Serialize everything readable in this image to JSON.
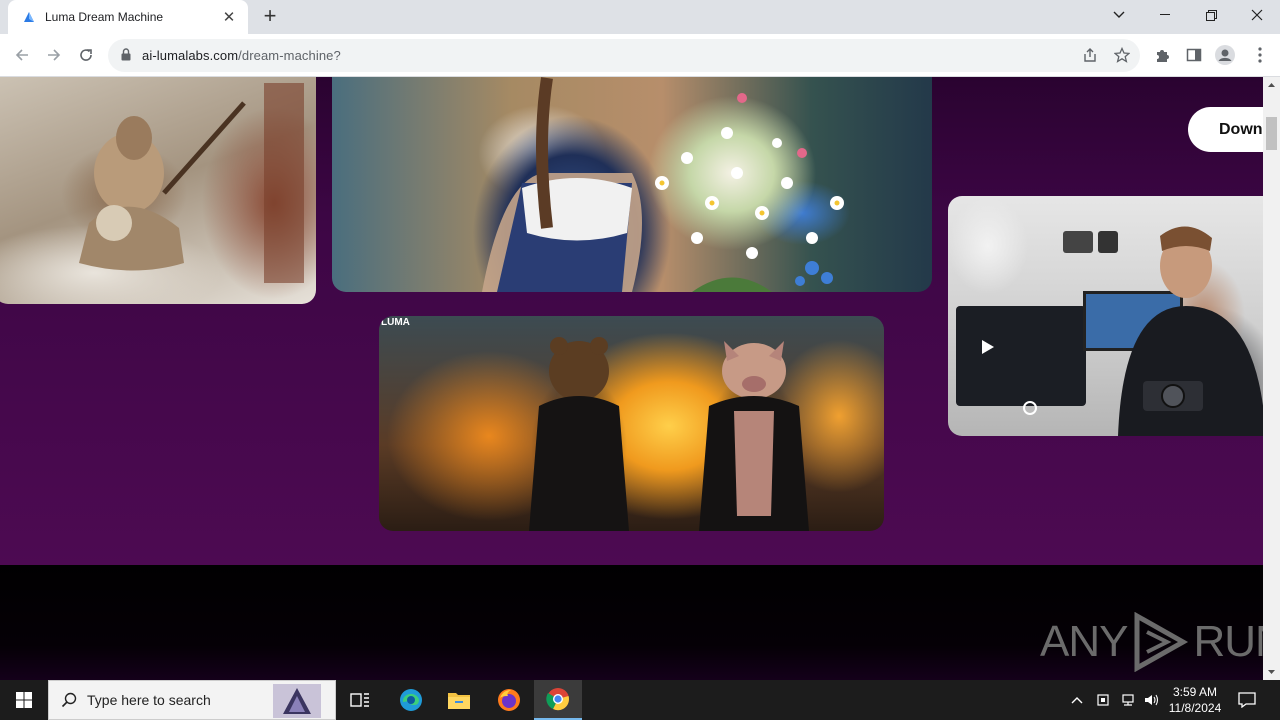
{
  "browser": {
    "tab_title": "Luma Dream Machine",
    "url_host": "ai-lumalabs.com",
    "url_path": "/dream-machine?"
  },
  "page": {
    "cta_label": "Down",
    "video_watermark": "LUMA",
    "accent_purple": "#4d0a52",
    "brand_watermark_left": "ANY",
    "brand_watermark_right": "RUN"
  },
  "taskbar": {
    "search_placeholder": "Type here to search",
    "time": "3:59 AM",
    "date": "11/8/2024"
  }
}
